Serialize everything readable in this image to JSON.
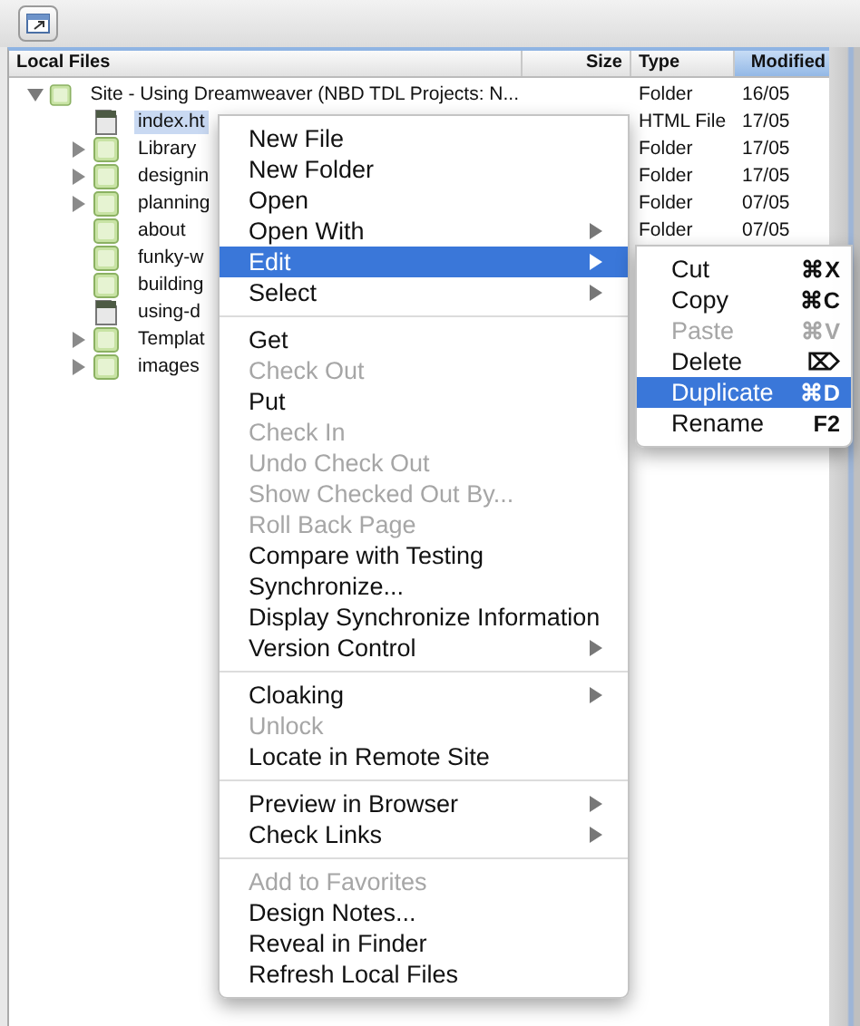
{
  "panel": {
    "columns": [
      {
        "label": "Local Files",
        "sorted": false
      },
      {
        "label": "Size",
        "sorted": false
      },
      {
        "label": "Type",
        "sorted": false
      },
      {
        "label": "Modified",
        "sorted": true
      }
    ],
    "tree": [
      {
        "name": "Site - Using Dreamweaver (NBD TDL Projects: N...",
        "kind": "folder",
        "expanded": true,
        "selected": false,
        "type": "Folder",
        "modified": "16/05",
        "children": [
          {
            "name": "index.ht",
            "kind": "file",
            "selected": true,
            "type": "HTML File",
            "modified": "17/05"
          },
          {
            "name": "Library",
            "kind": "folder",
            "expanded": false,
            "selected": false,
            "type": "Folder",
            "modified": "17/05"
          },
          {
            "name": "designin",
            "kind": "folder",
            "expanded": false,
            "selected": false,
            "type": "Folder",
            "modified": "17/05"
          },
          {
            "name": "planning",
            "kind": "folder",
            "expanded": false,
            "selected": false,
            "type": "Folder",
            "modified": "07/05"
          },
          {
            "name": "about",
            "kind": "folder",
            "selected": false,
            "type": "Folder",
            "modified": "07/05"
          },
          {
            "name": "funky-w",
            "kind": "folder",
            "selected": false
          },
          {
            "name": "building",
            "kind": "folder",
            "selected": false
          },
          {
            "name": "using-d",
            "kind": "file",
            "selected": false
          },
          {
            "name": "Templat",
            "kind": "folder",
            "expanded": false,
            "selected": false
          },
          {
            "name": "images",
            "kind": "folder",
            "expanded": false,
            "selected": false
          }
        ]
      }
    ]
  },
  "context_menu": {
    "items": [
      {
        "kind": "item",
        "label": "New File",
        "disabled": false,
        "submenu": false,
        "selected": false
      },
      {
        "kind": "item",
        "label": "New Folder",
        "disabled": false,
        "submenu": false,
        "selected": false
      },
      {
        "kind": "item",
        "label": "Open",
        "disabled": false,
        "submenu": false,
        "selected": false
      },
      {
        "kind": "item",
        "label": "Open With",
        "disabled": false,
        "submenu": true,
        "selected": false
      },
      {
        "kind": "item",
        "label": "Edit",
        "disabled": false,
        "submenu": true,
        "selected": true
      },
      {
        "kind": "item",
        "label": "Select",
        "disabled": false,
        "submenu": true,
        "selected": false
      },
      {
        "kind": "separator"
      },
      {
        "kind": "item",
        "label": "Get",
        "disabled": false,
        "submenu": false,
        "selected": false
      },
      {
        "kind": "item",
        "label": "Check Out",
        "disabled": true,
        "submenu": false,
        "selected": false
      },
      {
        "kind": "item",
        "label": "Put",
        "disabled": false,
        "submenu": false,
        "selected": false
      },
      {
        "kind": "item",
        "label": "Check In",
        "disabled": true,
        "submenu": false,
        "selected": false
      },
      {
        "kind": "item",
        "label": "Undo Check Out",
        "disabled": true,
        "submenu": false,
        "selected": false
      },
      {
        "kind": "item",
        "label": "Show Checked Out By...",
        "disabled": true,
        "submenu": false,
        "selected": false
      },
      {
        "kind": "item",
        "label": "Roll Back Page",
        "disabled": true,
        "submenu": false,
        "selected": false
      },
      {
        "kind": "item",
        "label": "Compare with Testing",
        "disabled": false,
        "submenu": false,
        "selected": false
      },
      {
        "kind": "item",
        "label": "Synchronize...",
        "disabled": false,
        "submenu": false,
        "selected": false
      },
      {
        "kind": "item",
        "label": "Display Synchronize Information",
        "disabled": false,
        "submenu": false,
        "selected": false
      },
      {
        "kind": "item",
        "label": "Version Control",
        "disabled": false,
        "submenu": true,
        "selected": false
      },
      {
        "kind": "separator"
      },
      {
        "kind": "item",
        "label": "Cloaking",
        "disabled": false,
        "submenu": true,
        "selected": false
      },
      {
        "kind": "item",
        "label": "Unlock",
        "disabled": true,
        "submenu": false,
        "selected": false
      },
      {
        "kind": "item",
        "label": "Locate in Remote Site",
        "disabled": false,
        "submenu": false,
        "selected": false
      },
      {
        "kind": "separator"
      },
      {
        "kind": "item",
        "label": "Preview in Browser",
        "disabled": false,
        "submenu": true,
        "selected": false
      },
      {
        "kind": "item",
        "label": "Check Links",
        "disabled": false,
        "submenu": true,
        "selected": false
      },
      {
        "kind": "separator"
      },
      {
        "kind": "item",
        "label": "Add to Favorites",
        "disabled": true,
        "submenu": false,
        "selected": false
      },
      {
        "kind": "item",
        "label": "Design Notes...",
        "disabled": false,
        "submenu": false,
        "selected": false
      },
      {
        "kind": "item",
        "label": "Reveal in Finder",
        "disabled": false,
        "submenu": false,
        "selected": false
      },
      {
        "kind": "item",
        "label": "Refresh Local Files",
        "disabled": false,
        "submenu": false,
        "selected": false
      }
    ]
  },
  "edit_submenu": {
    "items": [
      {
        "kind": "item",
        "label": "Cut",
        "shortcut": "⌘X",
        "disabled": false,
        "selected": false
      },
      {
        "kind": "item",
        "label": "Copy",
        "shortcut": "⌘C",
        "disabled": false,
        "selected": false
      },
      {
        "kind": "item",
        "label": "Paste",
        "shortcut": "⌘V",
        "disabled": true,
        "selected": false
      },
      {
        "kind": "item",
        "label": "Delete",
        "shortcut": "⌦",
        "disabled": false,
        "selected": false
      },
      {
        "kind": "item",
        "label": "Duplicate",
        "shortcut": "⌘D",
        "disabled": false,
        "selected": true
      },
      {
        "kind": "item",
        "label": "Rename",
        "shortcut": "F2",
        "disabled": false,
        "selected": false
      }
    ]
  }
}
